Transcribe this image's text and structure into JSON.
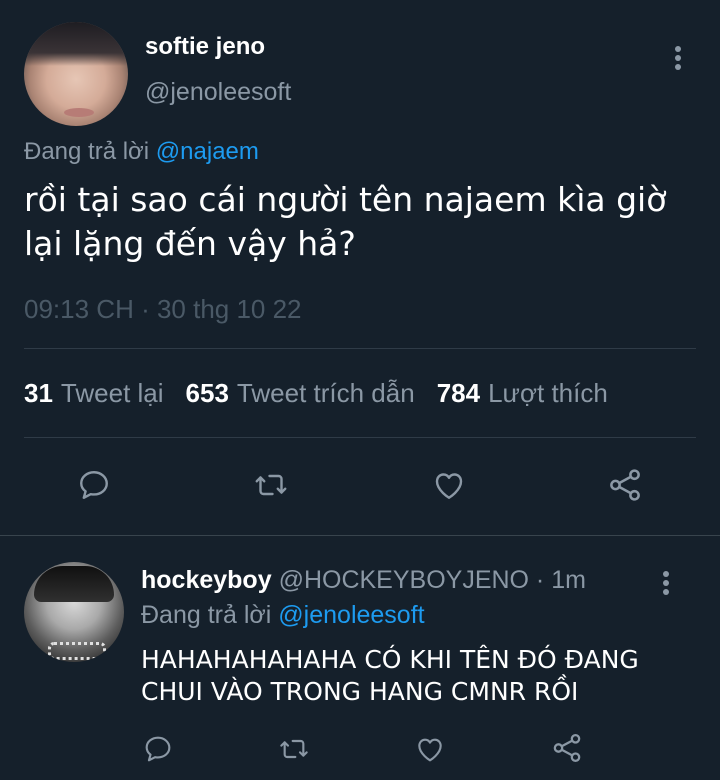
{
  "main_tweet": {
    "display_name": "softie jeno",
    "handle": "@jenoleesoft",
    "replying_prefix": "Đang trả lời",
    "replying_to": "@najaem",
    "text": "rồi tại sao cái người tên najaem kìa giờ lại lặng đến vậy hả?",
    "timestamp": "09:13 CH · 30 thg 10 22",
    "stats": {
      "retweets_count": "31",
      "retweets_label": "Tweet lại",
      "quotes_count": "653",
      "quotes_label": "Tweet trích dẫn",
      "likes_count": "784",
      "likes_label": "Lượt thích"
    }
  },
  "reply_tweet": {
    "display_name": "hockeyboy",
    "handle_time": "@HOCKEYBOYJENO · 1m",
    "replying_prefix": "Đang trả lời",
    "replying_to": "@jenoleesoft",
    "text": "HAHAHAHAHAHA CÓ KHI TÊN ĐÓ ĐANG CHUI VÀO TRONG HANG CMNR RỒI"
  },
  "icons": [
    "reply-icon",
    "retweet-icon",
    "like-icon",
    "share-icon",
    "more-options-icon"
  ],
  "colors": {
    "background": "#15202b",
    "accent": "#1d9bf0",
    "secondary_text": "#8b98a5",
    "muted_text": "#4a5966",
    "divider": "#2f3b47"
  }
}
